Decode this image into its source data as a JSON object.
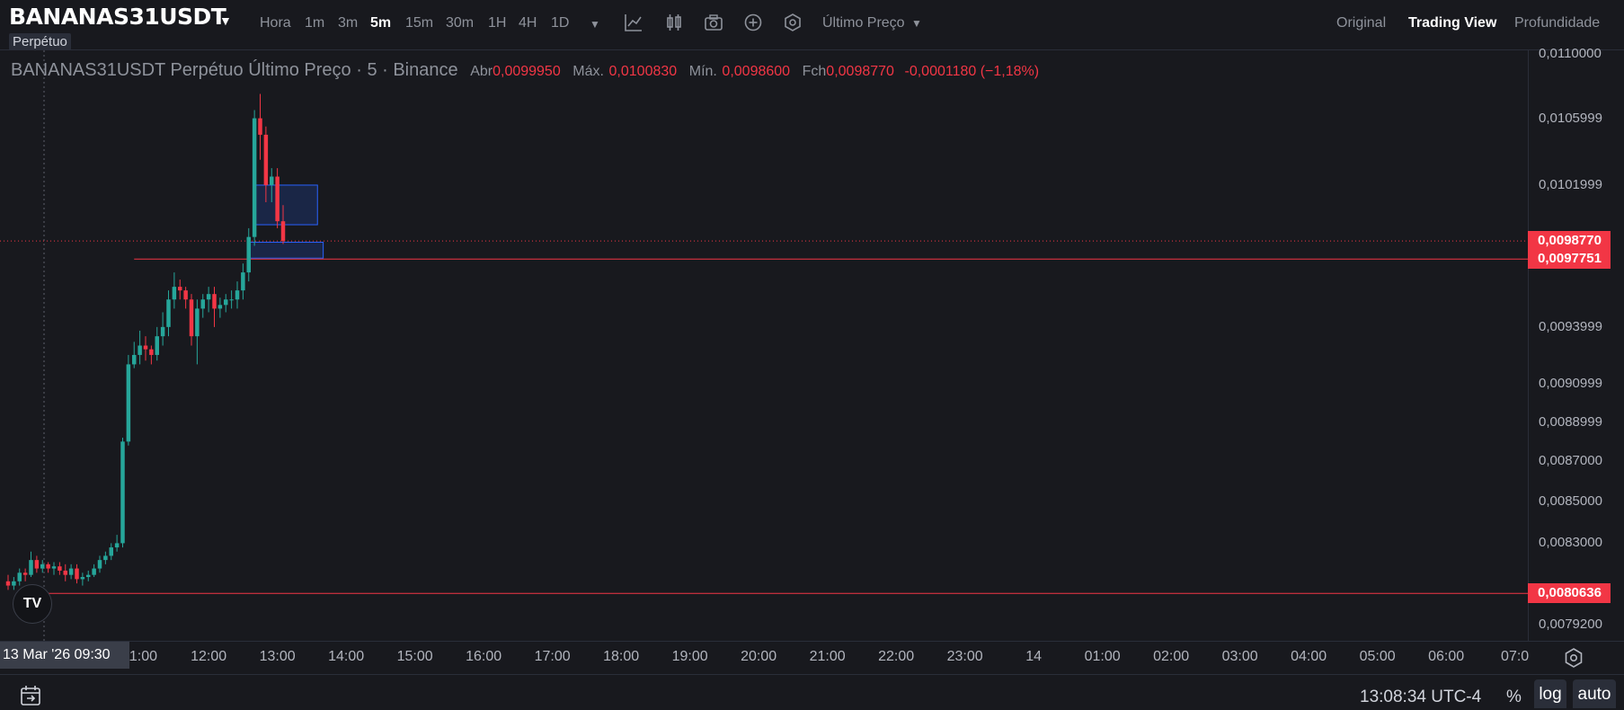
{
  "header": {
    "symbol": "BANANAS31USDT",
    "contract_type": "Perpétuo",
    "timeframes": [
      "Hora",
      "1m",
      "3m",
      "5m",
      "15m",
      "30m",
      "1H",
      "4H",
      "1D"
    ],
    "active_timeframe": "5m",
    "price_type": "Último Preço",
    "views": [
      "Original",
      "Trading View",
      "Profundidade"
    ],
    "active_view": "Trading View"
  },
  "legend": {
    "title": "BANANAS31USDT Perpétuo Último Preço · 5 · Binance",
    "open_label": "Abr",
    "open": "0,0099950",
    "high_label": "Máx.",
    "high": "0,0100830",
    "low_label": "Mín.",
    "low": "0,0098600",
    "close_label": "Fch",
    "close": "0,0098770",
    "change": "-0,0001180 (−1,18%)"
  },
  "price_axis": {
    "ticks": [
      {
        "label": "0,0110000",
        "value": 0.011
      },
      {
        "label": "0,0105999",
        "value": 0.0105999
      },
      {
        "label": "0,0101999",
        "value": 0.0101999
      },
      {
        "label": "0,0093999",
        "value": 0.0093999
      },
      {
        "label": "0,0090999",
        "value": 0.0090999
      },
      {
        "label": "0,0088999",
        "value": 0.0088999
      },
      {
        "label": "0,0087000",
        "value": 0.0087
      },
      {
        "label": "0,0085000",
        "value": 0.0085
      },
      {
        "label": "0,0083000",
        "value": 0.0083
      },
      {
        "label": "0,0079200",
        "value": 0.00792
      }
    ],
    "price_labels": [
      {
        "label": "0,0098770",
        "value": 0.009877
      },
      {
        "label": "0,0097751",
        "value": 0.0097751
      },
      {
        "label": "0,0080636",
        "value": 0.0080636
      }
    ]
  },
  "time_axis": {
    "date_label": "13 Mar '26   09:30",
    "ticks": [
      "11:00",
      "12:00",
      "13:00",
      "14:00",
      "15:00",
      "16:00",
      "17:00",
      "18:00",
      "19:00",
      "20:00",
      "21:00",
      "22:00",
      "23:00",
      "14",
      "01:00",
      "02:00",
      "03:00",
      "04:00",
      "05:00",
      "06:00",
      "07:0"
    ]
  },
  "footer": {
    "clock": "13:08:34 UTC-4",
    "percent": "%",
    "log": "log",
    "auto": "auto"
  },
  "colors": {
    "up": "#26a69a",
    "down": "#f23645",
    "background": "#18191e"
  },
  "chart_data": {
    "type": "candlestick",
    "timeframe": "5m",
    "x": [
      "09:05",
      "09:10",
      "09:15",
      "09:20",
      "09:25",
      "09:30",
      "09:35",
      "09:40",
      "09:45",
      "09:50",
      "09:55",
      "10:00",
      "10:05",
      "10:10",
      "10:15",
      "10:20",
      "10:25",
      "10:30",
      "10:35",
      "10:40",
      "10:45",
      "10:50",
      "10:55",
      "11:00",
      "11:05",
      "11:10",
      "11:15",
      "11:20",
      "11:25",
      "11:30",
      "11:35",
      "11:40",
      "11:45",
      "11:50",
      "11:55",
      "12:00",
      "12:05",
      "12:10",
      "12:15",
      "12:20",
      "12:25",
      "12:30",
      "12:35",
      "12:40",
      "12:45",
      "12:50",
      "12:55",
      "13:00",
      "13:05"
    ],
    "open": [
      0.00812,
      0.0081,
      0.00812,
      0.00816,
      0.00815,
      0.00822,
      0.00818,
      0.0082,
      0.00818,
      0.00819,
      0.00817,
      0.00815,
      0.00818,
      0.00813,
      0.00814,
      0.00815,
      0.00818,
      0.00822,
      0.00824,
      0.00828,
      0.0083,
      0.0088,
      0.0092,
      0.00925,
      0.0093,
      0.00928,
      0.00925,
      0.00935,
      0.0094,
      0.00955,
      0.00962,
      0.0096,
      0.00955,
      0.00935,
      0.0095,
      0.00955,
      0.00958,
      0.0095,
      0.00952,
      0.00955,
      0.00955,
      0.0096,
      0.0097,
      0.0099,
      0.0106,
      0.0105,
      0.0102,
      0.01025,
      0.00999
    ],
    "close": [
      0.0081,
      0.00812,
      0.00816,
      0.00815,
      0.00822,
      0.00818,
      0.0082,
      0.00818,
      0.00819,
      0.00817,
      0.00815,
      0.00818,
      0.00813,
      0.00814,
      0.00815,
      0.00818,
      0.00822,
      0.00824,
      0.00828,
      0.0083,
      0.0088,
      0.0092,
      0.00925,
      0.0093,
      0.00928,
      0.00925,
      0.00935,
      0.0094,
      0.00955,
      0.00962,
      0.0096,
      0.00955,
      0.00935,
      0.0095,
      0.00955,
      0.00958,
      0.0095,
      0.00952,
      0.00955,
      0.00955,
      0.0096,
      0.0097,
      0.0099,
      0.0106,
      0.0105,
      0.0102,
      0.01025,
      0.00999,
      0.009877
    ],
    "high": [
      0.00815,
      0.00814,
      0.00818,
      0.00818,
      0.00826,
      0.00824,
      0.00822,
      0.00821,
      0.00821,
      0.00821,
      0.0082,
      0.0082,
      0.0082,
      0.00816,
      0.00817,
      0.0082,
      0.00824,
      0.00826,
      0.0083,
      0.00834,
      0.00882,
      0.00925,
      0.00932,
      0.00938,
      0.00935,
      0.0093,
      0.0094,
      0.00948,
      0.0096,
      0.0097,
      0.00966,
      0.00962,
      0.00958,
      0.00955,
      0.00958,
      0.00962,
      0.00962,
      0.00956,
      0.00958,
      0.0096,
      0.00965,
      0.00975,
      0.00995,
      0.01065,
      0.01075,
      0.01055,
      0.0103,
      0.0103,
      0.010083
    ],
    "low": [
      0.00808,
      0.00808,
      0.0081,
      0.00812,
      0.00814,
      0.00816,
      0.00816,
      0.00816,
      0.00815,
      0.00815,
      0.00812,
      0.00813,
      0.00811,
      0.0081,
      0.00812,
      0.00814,
      0.00816,
      0.0082,
      0.00822,
      0.00826,
      0.00828,
      0.00878,
      0.00918,
      0.0092,
      0.00922,
      0.0092,
      0.00922,
      0.0093,
      0.00935,
      0.0095,
      0.00955,
      0.0095,
      0.0093,
      0.0092,
      0.00945,
      0.00948,
      0.0094,
      0.00945,
      0.00948,
      0.0095,
      0.0095,
      0.00955,
      0.00965,
      0.00985,
      0.01035,
      0.0101,
      0.0101,
      0.00995,
      0.00986
    ],
    "horizontal_lines": [
      0.0097751,
      0.0080636
    ],
    "last_price": 0.009877,
    "zones": [
      {
        "from_time": "12:40",
        "to_time": "13:35",
        "price_top": 0.0102,
        "price_bottom": 0.00997
      },
      {
        "from_time": "12:35",
        "to_time": "13:40",
        "price_top": 0.00987,
        "price_bottom": 0.00978
      }
    ],
    "ylim": [
      0.00792,
      0.011
    ],
    "scale": "log"
  }
}
